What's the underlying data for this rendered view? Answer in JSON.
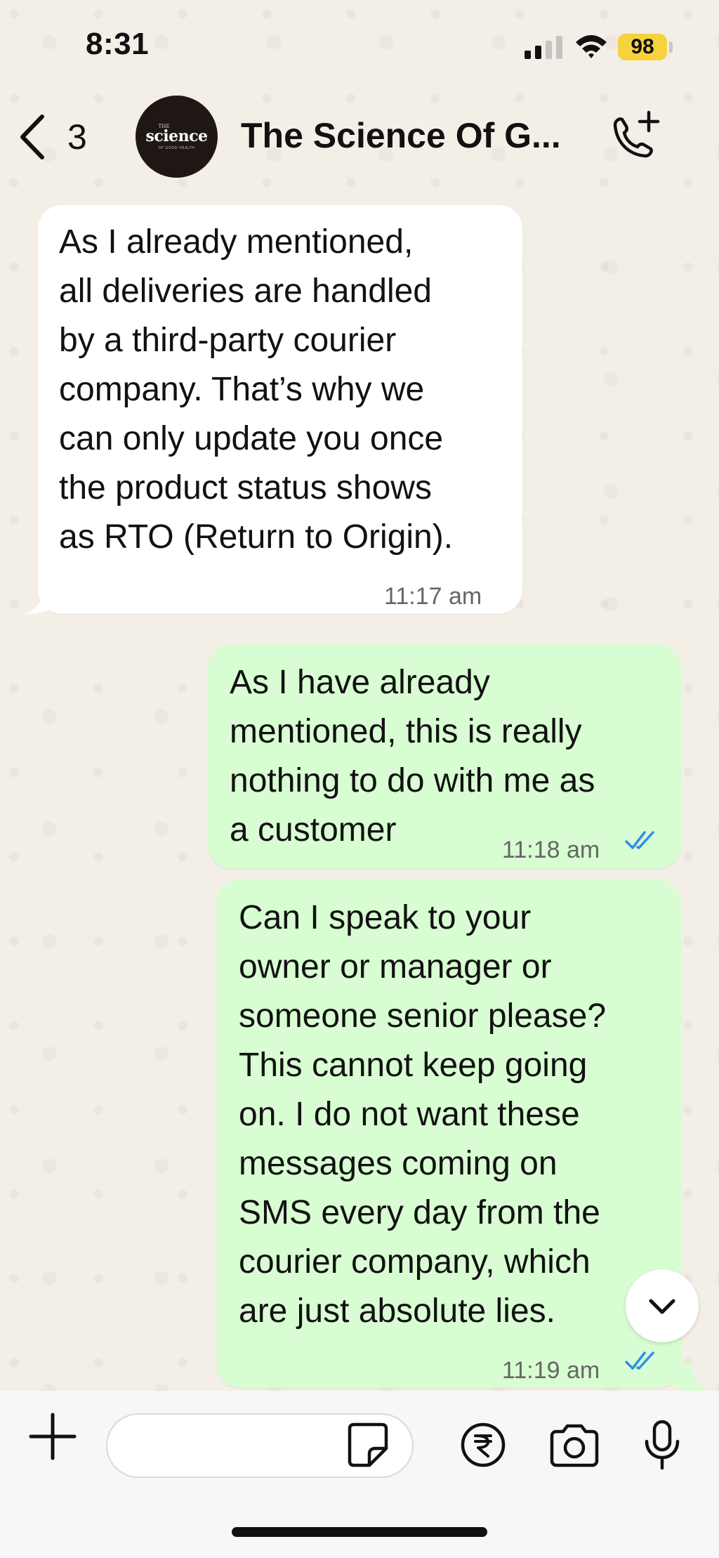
{
  "status_bar": {
    "time": "8:31",
    "battery": "98",
    "battery_color": "#f6d23c"
  },
  "header": {
    "back_count": "3",
    "avatar": {
      "top": "THE",
      "main": "science",
      "sub": "OF GOOD HEALTH"
    },
    "title": "The Science Of G...",
    "call_icon": "phone-add-icon"
  },
  "messages": [
    {
      "direction": "incoming",
      "text": "As I already mentioned,\nall deliveries are handled\nby a third-party courier\ncompany. That’s why we\ncan only update you once\nthe product status shows\nas RTO (Return to Origin).",
      "time": "11:17 am"
    },
    {
      "direction": "outgoing",
      "text": "As I have already\nmentioned, this is really\nnothing to do with me as\na customer",
      "time": "11:18 am",
      "status": "read"
    },
    {
      "direction": "outgoing",
      "text": "Can I speak to your\nowner or manager or\nsomeone senior please?\nThis cannot keep going\non. I do not want these\nmessages coming on\nSMS every day from the\ncourier company, which\nare just absolute lies.",
      "time": "11:19 am",
      "status": "read"
    }
  ],
  "composer": {
    "value": "",
    "icons": [
      "plus-icon",
      "sticker-icon",
      "rupee-payment-icon",
      "camera-icon",
      "microphone-icon"
    ]
  },
  "colors": {
    "outgoing_bubble": "#d9fdd3",
    "incoming_bubble": "#ffffff",
    "read_ticks": "#2f8fe8",
    "wallpaper": "#f3efe6"
  }
}
